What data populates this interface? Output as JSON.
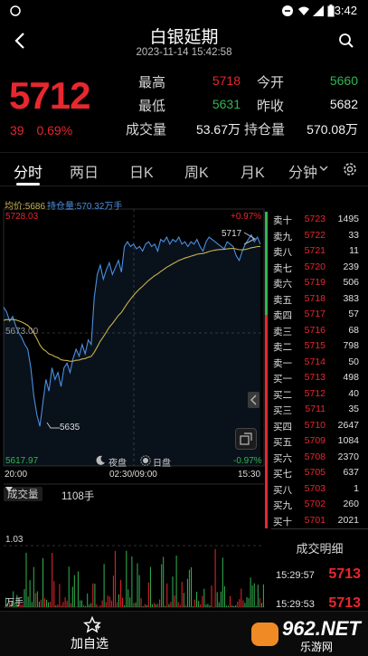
{
  "status_bar": {
    "time": "3:42"
  },
  "header": {
    "title": "白银延期",
    "subtitle": "2023-11-14 15:42:58"
  },
  "quote": {
    "price": "5712",
    "change": "39",
    "change_pct": "0.69%",
    "high_label": "最高",
    "high": "5718",
    "open_label": "今开",
    "open": "5660",
    "low_label": "最低",
    "low": "5631",
    "prev_close_label": "昨收",
    "prev_close": "5682",
    "volume_label": "成交量",
    "volume": "53.67万",
    "position_label": "持仓量",
    "position": "570.08万"
  },
  "tabs": [
    {
      "label": "分时",
      "active": true
    },
    {
      "label": "两日"
    },
    {
      "label": "日K"
    },
    {
      "label": "周K"
    },
    {
      "label": "月K"
    },
    {
      "label": "分钟"
    }
  ],
  "chart": {
    "avg_label": "均价:5686",
    "pos_label": "持仓量:570.32万手",
    "top_price": "5728.03",
    "mid_price": "5673.00",
    "bottom_price": "5617.97",
    "top_pct": "+0.97%",
    "bottom_pct": "-0.97%",
    "peak_marker": "5717",
    "low_marker": "5635",
    "night_label": "夜盘",
    "day_label": "日盘",
    "time_start": "20:00",
    "time_mid": "02:30/09:00",
    "time_end": "15:30",
    "volume_selector": "成交量",
    "volume_unit": "1108手",
    "vol_max": "1.03",
    "vol_unit_bottom": "万手"
  },
  "order_book": {
    "asks": [
      {
        "label": "卖十",
        "price": "5723",
        "vol": "1495"
      },
      {
        "label": "卖九",
        "price": "5722",
        "vol": "33"
      },
      {
        "label": "卖八",
        "price": "5721",
        "vol": "11"
      },
      {
        "label": "卖七",
        "price": "5720",
        "vol": "239"
      },
      {
        "label": "卖六",
        "price": "5719",
        "vol": "506"
      },
      {
        "label": "卖五",
        "price": "5718",
        "vol": "383"
      },
      {
        "label": "卖四",
        "price": "5717",
        "vol": "57"
      },
      {
        "label": "卖三",
        "price": "5716",
        "vol": "68"
      },
      {
        "label": "卖二",
        "price": "5715",
        "vol": "798"
      },
      {
        "label": "卖一",
        "price": "5714",
        "vol": "50"
      }
    ],
    "bids": [
      {
        "label": "买一",
        "price": "5713",
        "vol": "498"
      },
      {
        "label": "买二",
        "price": "5712",
        "vol": "40"
      },
      {
        "label": "买三",
        "price": "5711",
        "vol": "35"
      },
      {
        "label": "买四",
        "price": "5710",
        "vol": "2647"
      },
      {
        "label": "买五",
        "price": "5709",
        "vol": "1084"
      },
      {
        "label": "买六",
        "price": "5708",
        "vol": "2370"
      },
      {
        "label": "买七",
        "price": "5705",
        "vol": "637"
      },
      {
        "label": "买八",
        "price": "5703",
        "vol": "1"
      },
      {
        "label": "买九",
        "price": "5702",
        "vol": "260"
      },
      {
        "label": "买十",
        "price": "5701",
        "vol": "2021"
      }
    ]
  },
  "trade_detail": {
    "title": "成交明细",
    "rows": [
      {
        "time": "15:29:57",
        "price": "5713"
      },
      {
        "time": "15:29:53",
        "price": "5713"
      }
    ]
  },
  "bottom_bar": {
    "watch_label": "加自选",
    "brand": "962.NET",
    "brand_sub": "乐游网"
  },
  "colors": {
    "up": "#e8272f",
    "down": "#32b550",
    "price_line": "#4a8fe0",
    "avg_line": "#c9b24a"
  }
}
